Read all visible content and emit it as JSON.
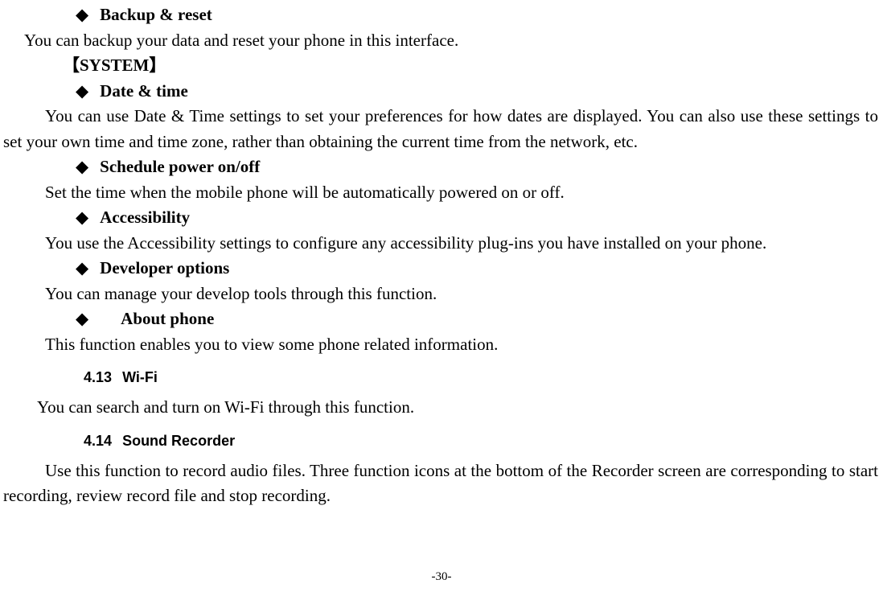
{
  "items": {
    "backup": {
      "title": "Backup & reset",
      "desc": "You can backup your data and reset your phone in this interface."
    },
    "system_label": "【SYSTEM】",
    "datetime": {
      "title": "Date & time",
      "desc": "You can use Date & Time settings to set your preferences for how dates are displayed. You can also use these settings to set your own time and time zone, rather than obtaining the current time from the network, etc."
    },
    "schedule": {
      "title": "Schedule power on/off",
      "desc": "Set the time when the mobile phone will be automatically powered on or off."
    },
    "accessibility": {
      "title": "Accessibility",
      "desc": "You use the Accessibility settings to configure any accessibility plug-ins you have installed on your phone."
    },
    "developer": {
      "title": "Developer options",
      "desc": "You can manage your develop tools through this function."
    },
    "about": {
      "title": "About phone",
      "desc": "This function enables you to view some phone related information."
    }
  },
  "sections": {
    "wifi": {
      "num": "4.13",
      "title": "Wi-Fi",
      "desc": "You can search and turn on Wi-Fi through this function."
    },
    "recorder": {
      "num": "4.14",
      "title": "Sound Recorder",
      "desc": "Use this function to record audio files. Three function icons at the bottom of the Recorder screen are corresponding to start recording, review record file and stop recording."
    }
  },
  "page_number": "-30-"
}
